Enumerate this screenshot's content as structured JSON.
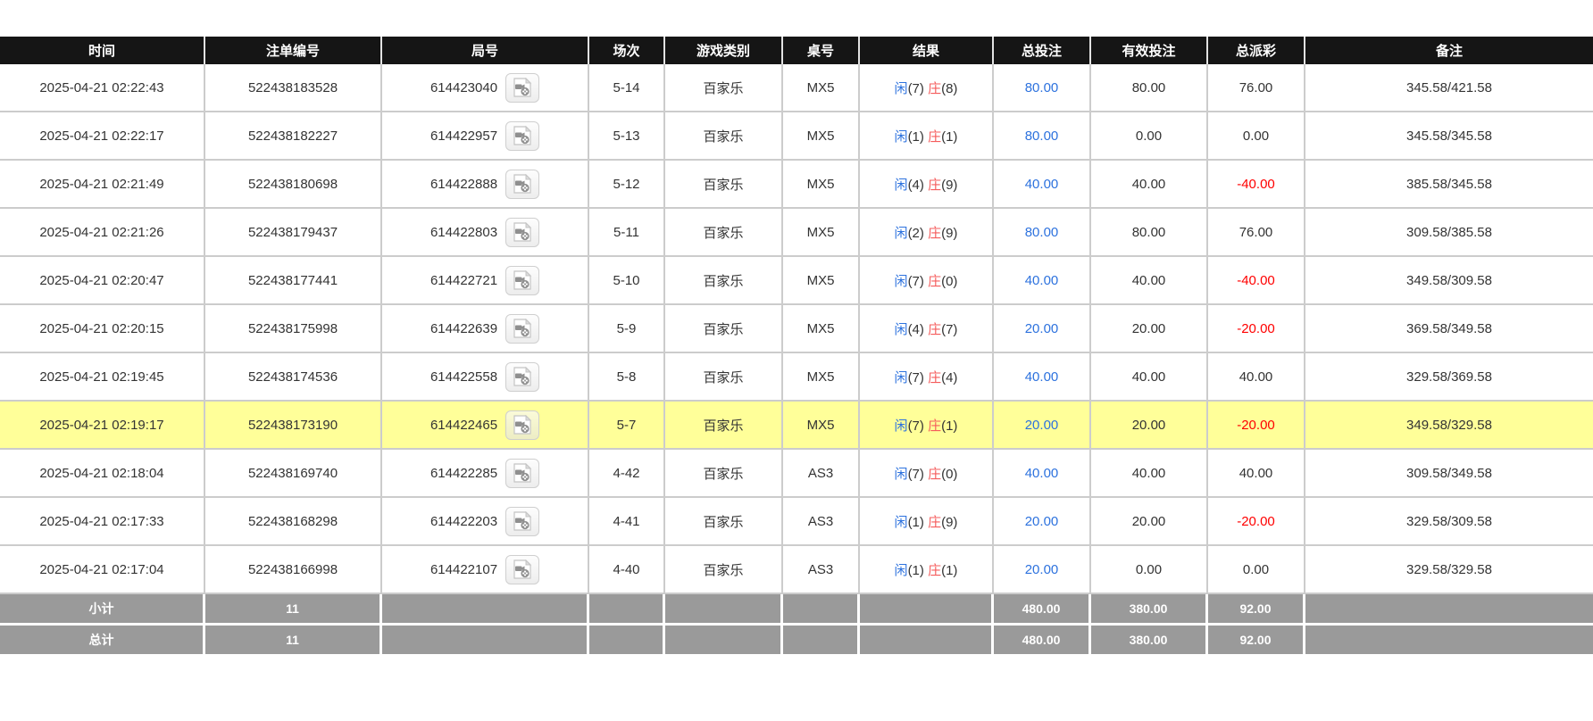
{
  "colors": {
    "header_bg": "#151515",
    "header_text": "#ffffff",
    "row_text": "#333333",
    "border": "#cccccc",
    "bet_amount_blue": "#2d72de",
    "player_blue": "#2d72de",
    "banker_red": "#f55c5c",
    "negative_red": "#ff0000",
    "highlight_yellow": "#ffff99",
    "footer_bg": "#9a9a9a",
    "footer_text": "#ffffff"
  },
  "icons": {
    "round_video": "video-file-icon"
  },
  "table": {
    "columns": [
      "时间",
      "注单编号",
      "局号",
      "场次",
      "游戏类别",
      "桌号",
      "结果",
      "总投注",
      "有效投注",
      "总派彩",
      "备注"
    ],
    "rows": [
      {
        "time": "2025-04-21 02:22:43",
        "bet_no": "522438183528",
        "round_no": "614423040",
        "session": "5-14",
        "game": "百家乐",
        "table_no": "MX5",
        "player_label": "闲",
        "player_score": "(7)",
        "banker_label": "庄",
        "banker_score": "(8)",
        "total_bet": "80.00",
        "valid_bet": "80.00",
        "payout": "76.00",
        "remark": "345.58/421.58",
        "highlighted": false
      },
      {
        "time": "2025-04-21 02:22:17",
        "bet_no": "522438182227",
        "round_no": "614422957",
        "session": "5-13",
        "game": "百家乐",
        "table_no": "MX5",
        "player_label": "闲",
        "player_score": "(1)",
        "banker_label": "庄",
        "banker_score": "(1)",
        "total_bet": "80.00",
        "valid_bet": "0.00",
        "payout": "0.00",
        "remark": "345.58/345.58",
        "highlighted": false
      },
      {
        "time": "2025-04-21 02:21:49",
        "bet_no": "522438180698",
        "round_no": "614422888",
        "session": "5-12",
        "game": "百家乐",
        "table_no": "MX5",
        "player_label": "闲",
        "player_score": "(4)",
        "banker_label": "庄",
        "banker_score": "(9)",
        "total_bet": "40.00",
        "valid_bet": "40.00",
        "payout": "-40.00",
        "remark": "385.58/345.58",
        "highlighted": false
      },
      {
        "time": "2025-04-21 02:21:26",
        "bet_no": "522438179437",
        "round_no": "614422803",
        "session": "5-11",
        "game": "百家乐",
        "table_no": "MX5",
        "player_label": "闲",
        "player_score": "(2)",
        "banker_label": "庄",
        "banker_score": "(9)",
        "total_bet": "80.00",
        "valid_bet": "80.00",
        "payout": "76.00",
        "remark": "309.58/385.58",
        "highlighted": false
      },
      {
        "time": "2025-04-21 02:20:47",
        "bet_no": "522438177441",
        "round_no": "614422721",
        "session": "5-10",
        "game": "百家乐",
        "table_no": "MX5",
        "player_label": "闲",
        "player_score": "(7)",
        "banker_label": "庄",
        "banker_score": "(0)",
        "total_bet": "40.00",
        "valid_bet": "40.00",
        "payout": "-40.00",
        "remark": "349.58/309.58",
        "highlighted": false
      },
      {
        "time": "2025-04-21 02:20:15",
        "bet_no": "522438175998",
        "round_no": "614422639",
        "session": "5-9",
        "game": "百家乐",
        "table_no": "MX5",
        "player_label": "闲",
        "player_score": "(4)",
        "banker_label": "庄",
        "banker_score": "(7)",
        "total_bet": "20.00",
        "valid_bet": "20.00",
        "payout": "-20.00",
        "remark": "369.58/349.58",
        "highlighted": false
      },
      {
        "time": "2025-04-21 02:19:45",
        "bet_no": "522438174536",
        "round_no": "614422558",
        "session": "5-8",
        "game": "百家乐",
        "table_no": "MX5",
        "player_label": "闲",
        "player_score": "(7)",
        "banker_label": "庄",
        "banker_score": "(4)",
        "total_bet": "40.00",
        "valid_bet": "40.00",
        "payout": "40.00",
        "remark": "329.58/369.58",
        "highlighted": false
      },
      {
        "time": "2025-04-21 02:19:17",
        "bet_no": "522438173190",
        "round_no": "614422465",
        "session": "5-7",
        "game": "百家乐",
        "table_no": "MX5",
        "player_label": "闲",
        "player_score": "(7)",
        "banker_label": "庄",
        "banker_score": "(1)",
        "total_bet": "20.00",
        "valid_bet": "20.00",
        "payout": "-20.00",
        "remark": "349.58/329.58",
        "highlighted": true
      },
      {
        "time": "2025-04-21 02:18:04",
        "bet_no": "522438169740",
        "round_no": "614422285",
        "session": "4-42",
        "game": "百家乐",
        "table_no": "AS3",
        "player_label": "闲",
        "player_score": "(7)",
        "banker_label": "庄",
        "banker_score": "(0)",
        "total_bet": "40.00",
        "valid_bet": "40.00",
        "payout": "40.00",
        "remark": "309.58/349.58",
        "highlighted": false
      },
      {
        "time": "2025-04-21 02:17:33",
        "bet_no": "522438168298",
        "round_no": "614422203",
        "session": "4-41",
        "game": "百家乐",
        "table_no": "AS3",
        "player_label": "闲",
        "player_score": "(1)",
        "banker_label": "庄",
        "banker_score": "(9)",
        "total_bet": "20.00",
        "valid_bet": "20.00",
        "payout": "-20.00",
        "remark": "329.58/309.58",
        "highlighted": false
      },
      {
        "time": "2025-04-21 02:17:04",
        "bet_no": "522438166998",
        "round_no": "614422107",
        "session": "4-40",
        "game": "百家乐",
        "table_no": "AS3",
        "player_label": "闲",
        "player_score": "(1)",
        "banker_label": "庄",
        "banker_score": "(1)",
        "total_bet": "20.00",
        "valid_bet": "0.00",
        "payout": "0.00",
        "remark": "329.58/329.58",
        "highlighted": false
      }
    ],
    "footer": {
      "subtotal": {
        "label": "小计",
        "count": "11",
        "total_bet": "480.00",
        "valid_bet": "380.00",
        "payout": "92.00"
      },
      "total": {
        "label": "总计",
        "count": "11",
        "total_bet": "480.00",
        "valid_bet": "380.00",
        "payout": "92.00"
      }
    }
  }
}
